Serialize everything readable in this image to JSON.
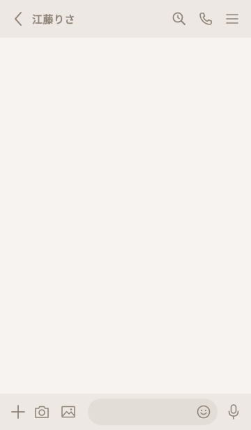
{
  "header": {
    "title": "江藤りさ",
    "icons": [
      "back-icon",
      "search-icon",
      "phone-icon",
      "menu-icon"
    ]
  },
  "footer": {
    "icons": [
      "plus-icon",
      "camera-icon",
      "image-icon",
      "emoji-icon",
      "microphone-icon"
    ],
    "message_value": "",
    "message_placeholder": ""
  },
  "colors": {
    "header_bg": "#ede8e3",
    "chat_bg": "#f7f3f0",
    "icon": "#8f8378",
    "input_bg": "#e3ddd7"
  }
}
